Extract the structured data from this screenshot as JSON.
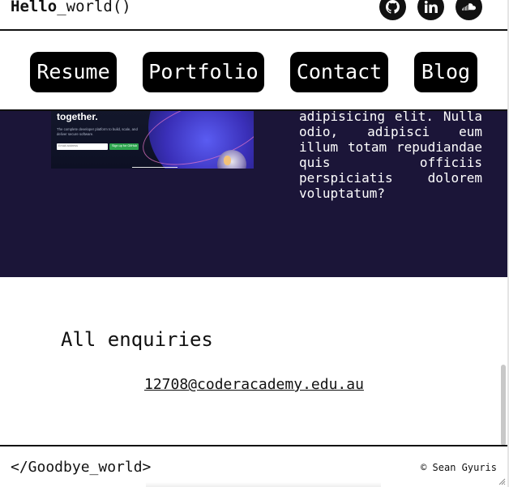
{
  "header": {
    "brand_bold": "Hello",
    "brand_rest": "_world()",
    "social": [
      {
        "icon": "github-icon"
      },
      {
        "icon": "linkedin-icon"
      },
      {
        "icon": "soundcloud-icon"
      }
    ]
  },
  "nav": {
    "items": [
      {
        "label": "Resume"
      },
      {
        "label": "Portfolio"
      },
      {
        "label": "Contact"
      },
      {
        "label": "Blog"
      }
    ]
  },
  "portfolio": {
    "screenshot": {
      "headline": "together.",
      "subtext": "The complete developer platform to build, scale, and deliver secure software.",
      "email_placeholder": "Email address",
      "signup_label": "Sign up for GitHub"
    },
    "description": "adipisicing elit. Nulla odio, adipisci eum illum totam repudiandae quis officiis perspiciatis dolorem voluptatum?"
  },
  "enquiries": {
    "title": "All enquiries",
    "email": "12708@coderacademy.edu.au"
  },
  "footer": {
    "left": "</Goodbye_world>",
    "right": "© Sean Gyuris"
  },
  "colors": {
    "dark_band": "#1b1538",
    "button": "#000000",
    "accent_green": "#2ea44f"
  }
}
